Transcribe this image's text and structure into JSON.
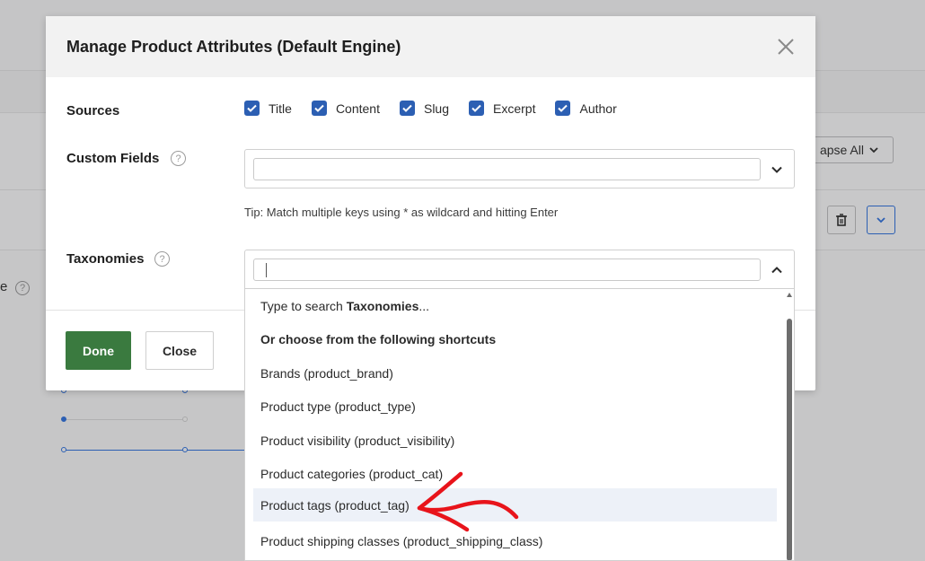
{
  "modal": {
    "title": "Manage Product Attributes (Default Engine)",
    "sources_label": "Sources",
    "sources": [
      {
        "label": "Title",
        "checked": true
      },
      {
        "label": "Content",
        "checked": true
      },
      {
        "label": "Slug",
        "checked": true
      },
      {
        "label": "Excerpt",
        "checked": true
      },
      {
        "label": "Author",
        "checked": true
      }
    ],
    "custom_fields_label": "Custom Fields",
    "custom_fields_value": "",
    "tip": "Tip: Match multiple keys using * as wildcard and hitting Enter",
    "taxonomies_label": "Taxonomies",
    "taxonomies_value": "",
    "done_label": "Done",
    "close_label": "Close",
    "help_glyph": "?"
  },
  "dropdown": {
    "search_hint_prefix": "Type to search ",
    "search_hint_bold": "Taxonomies",
    "search_hint_suffix": "...",
    "shortcuts_heading": "Or choose from the following shortcuts",
    "options": [
      "Brands (product_brand)",
      "Product type (product_type)",
      "Product visibility (product_visibility)",
      "Product categories (product_cat)",
      "Product tags (product_tag)",
      "Product shipping classes (product_shipping_class)"
    ],
    "highlighted_index": 4
  },
  "background": {
    "collapse_label": "apse All",
    "partial_label": "e"
  },
  "colors": {
    "accent": "#2c5fb3",
    "done_green": "#3a7a3f",
    "annotation_red": "#e8141b",
    "overlay": "#c6c6c7"
  }
}
